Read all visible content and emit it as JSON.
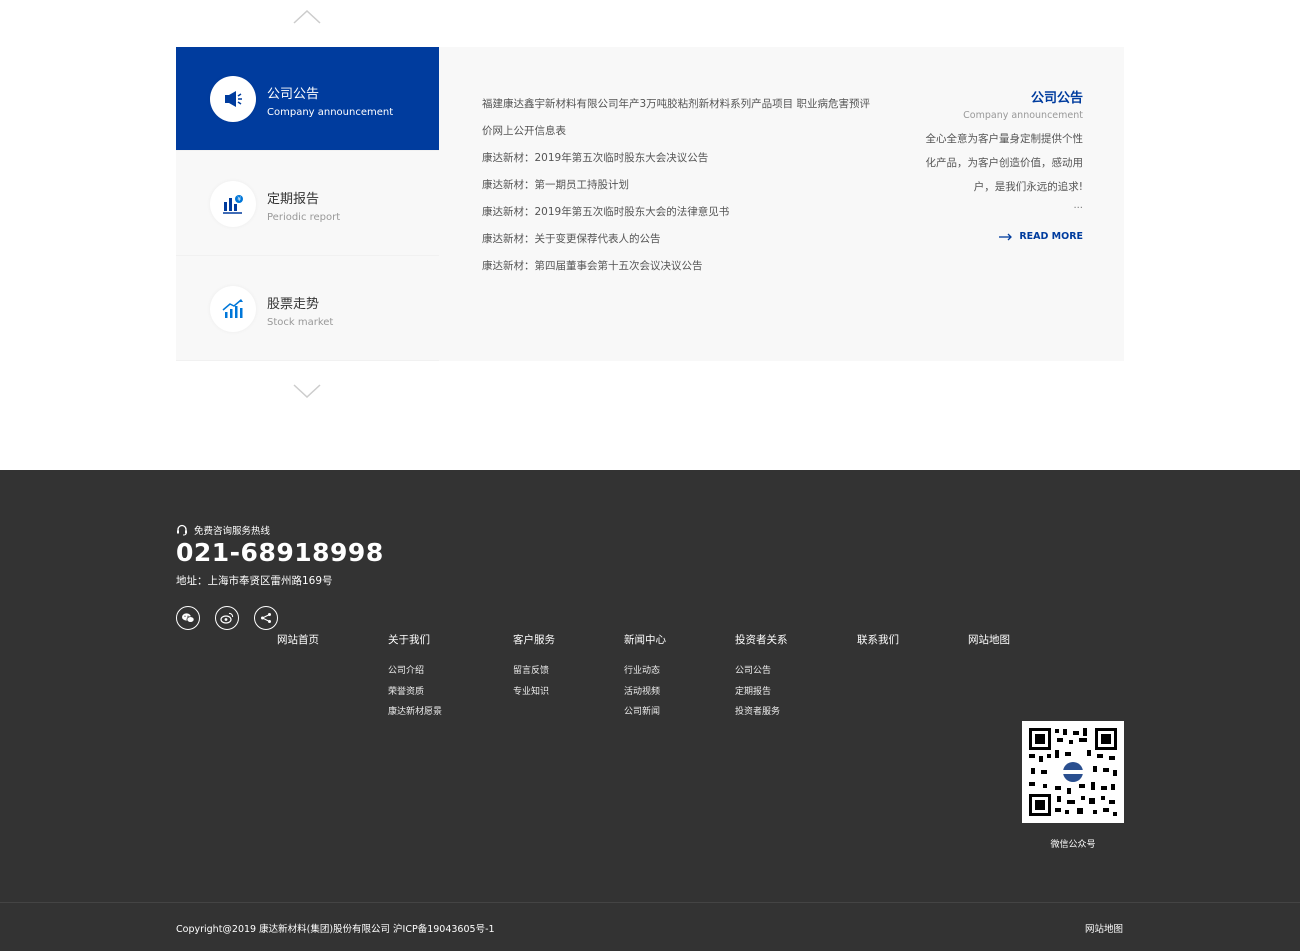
{
  "tabs": [
    {
      "title": "公司公告",
      "subtitle": "Company announcement",
      "icon": "megaphone-icon"
    },
    {
      "title": "定期报告",
      "subtitle": "Periodic report",
      "icon": "report-chart-icon"
    },
    {
      "title": "股票走势",
      "subtitle": "Stock market",
      "icon": "stock-trend-icon"
    }
  ],
  "news": [
    "福建康达鑫宇新材料有限公司年产3万吨胶粘剂新材料系列产品项目 职业病危害预评",
    "价网上公开信息表",
    "康达新材：2019年第五次临时股东大会决议公告",
    "康达新材：第一期员工持股计划",
    "康达新材：2019年第五次临时股东大会的法律意见书",
    "康达新材：关于变更保荐代表人的公告",
    "康达新材：第四届董事会第十五次会议决议公告"
  ],
  "intro": {
    "title": "公司公告",
    "subtitle": "Company announcement",
    "lines": [
      "全心全意为客户量身定制提供个性",
      "化产品，为客户创造价值，感动用",
      "户，是我们永远的追求!"
    ],
    "dots": "...",
    "read_more": "READ MORE"
  },
  "footer": {
    "hotline_label": "免费咨询服务热线",
    "hotline": "021-68918998",
    "address": "地址：上海市奉贤区雷州路169号",
    "socials": [
      "wechat-icon",
      "weibo-icon",
      "share-icon"
    ],
    "nav": [
      {
        "head": "网站首页",
        "links": []
      },
      {
        "head": "关于我们",
        "links": [
          "公司介绍",
          "荣誉资质",
          "康达新材愿景"
        ]
      },
      {
        "head": "客户服务",
        "links": [
          "留言反馈",
          "专业知识"
        ]
      },
      {
        "head": "新闻中心",
        "links": [
          "行业动态",
          "活动视频",
          "公司新闻"
        ]
      },
      {
        "head": "投资者关系",
        "links": [
          "公司公告",
          "定期报告",
          "投资者服务"
        ]
      },
      {
        "head": "联系我们",
        "links": []
      },
      {
        "head": "网站地图",
        "links": []
      }
    ],
    "qr_label": "微信公众号",
    "copyright": "Copyright@2019 康达新材料(集团)股份有限公司 沪ICP备19043605号-1",
    "sitemap": "网站地图"
  },
  "colors": {
    "brand": "#003c9e",
    "footer_bg": "#333333",
    "panel_bg": "#f8f8f8"
  }
}
